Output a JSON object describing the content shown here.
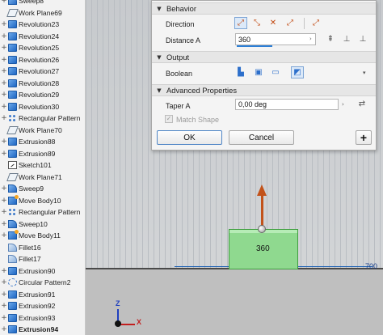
{
  "browser": {
    "items": [
      {
        "label": "Sweep8",
        "icon": "sweep-icon",
        "expand": "+"
      },
      {
        "label": "Work Plane69",
        "icon": "work-plane-icon",
        "expand": ""
      },
      {
        "label": "Revolution23",
        "icon": "solid-feature-icon",
        "expand": "+"
      },
      {
        "label": "Revolution24",
        "icon": "solid-feature-icon",
        "expand": "+"
      },
      {
        "label": "Revolution25",
        "icon": "solid-feature-icon",
        "expand": "+"
      },
      {
        "label": "Revolution26",
        "icon": "solid-feature-icon",
        "expand": "+"
      },
      {
        "label": "Revolution27",
        "icon": "solid-feature-icon",
        "expand": "+"
      },
      {
        "label": "Revolution28",
        "icon": "solid-feature-icon",
        "expand": "+"
      },
      {
        "label": "Revolution29",
        "icon": "solid-feature-icon",
        "expand": "+"
      },
      {
        "label": "Revolution30",
        "icon": "solid-feature-icon",
        "expand": "+"
      },
      {
        "label": "Rectangular Pattern",
        "icon": "rectangular-pattern-icon",
        "expand": "+"
      },
      {
        "label": "Work Plane70",
        "icon": "work-plane-icon",
        "expand": ""
      },
      {
        "label": "Extrusion88",
        "icon": "solid-feature-icon",
        "expand": "+"
      },
      {
        "label": "Extrusion89",
        "icon": "solid-feature-icon",
        "expand": "+"
      },
      {
        "label": "Sketch101",
        "icon": "sketch-icon",
        "expand": ""
      },
      {
        "label": "Work Plane71",
        "icon": "work-plane-icon",
        "expand": ""
      },
      {
        "label": "Sweep9",
        "icon": "sweep-icon",
        "expand": "+"
      },
      {
        "label": "Move Body10",
        "icon": "move-body-icon",
        "expand": "+"
      },
      {
        "label": "Rectangular Pattern",
        "icon": "rectangular-pattern-icon",
        "expand": "+"
      },
      {
        "label": "Sweep10",
        "icon": "sweep-icon",
        "expand": "+"
      },
      {
        "label": "Move Body11",
        "icon": "move-body-icon",
        "expand": "+"
      },
      {
        "label": "Fillet16",
        "icon": "fillet-icon",
        "expand": ""
      },
      {
        "label": "Fillet17",
        "icon": "fillet-icon",
        "expand": ""
      },
      {
        "label": "Extrusion90",
        "icon": "solid-feature-icon",
        "expand": "+"
      },
      {
        "label": "Circular Pattern2",
        "icon": "circular-pattern-icon",
        "expand": "+"
      },
      {
        "label": "Extrusion91",
        "icon": "solid-feature-icon",
        "expand": "+"
      },
      {
        "label": "Extrusion92",
        "icon": "solid-feature-icon",
        "expand": "+"
      },
      {
        "label": "Extrusion93",
        "icon": "solid-feature-icon",
        "expand": "+"
      },
      {
        "label": "Extrusion94",
        "icon": "solid-feature-icon",
        "expand": "+"
      }
    ]
  },
  "dialog": {
    "sections": {
      "behavior": "Behavior",
      "output": "Output",
      "advanced": "Advanced Properties"
    },
    "direction_label": "Direction",
    "distance_label": "Distance A",
    "distance_value": "360",
    "boolean_label": "Boolean",
    "taper_label": "Taper A",
    "taper_value": "0,00 deg",
    "match_shape_label": "Match Shape",
    "ok_label": "OK",
    "cancel_label": "Cancel",
    "plus_label": "+"
  },
  "viewport": {
    "preview_value": "360",
    "dimension_value": "700",
    "triad": {
      "z_label": "Z",
      "x_label": "X"
    },
    "preview_color": "#8fd98f",
    "arrow_color": "#c2521a"
  }
}
